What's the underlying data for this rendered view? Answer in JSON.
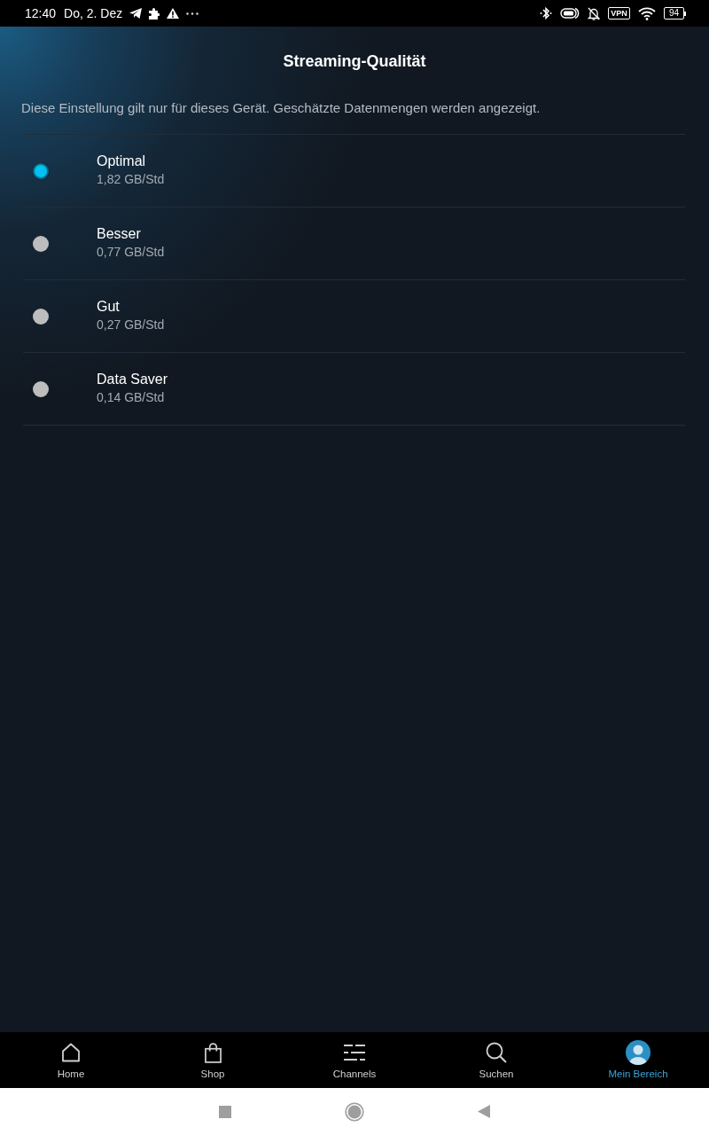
{
  "status_bar": {
    "time": "12:40",
    "date": "Do, 2. Dez",
    "vpn": "VPN",
    "battery": "94"
  },
  "header": {
    "title": "Streaming-Qualität",
    "description": "Diese Einstellung gilt nur für dieses Gerät. Geschätzte Datenmengen werden angezeigt."
  },
  "options": [
    {
      "label": "Optimal",
      "detail": "1,82 GB/Std",
      "selected": true
    },
    {
      "label": "Besser",
      "detail": "0,77 GB/Std",
      "selected": false
    },
    {
      "label": "Gut",
      "detail": "0,27 GB/Std",
      "selected": false
    },
    {
      "label": "Data Saver",
      "detail": "0,14 GB/Std",
      "selected": false
    }
  ],
  "bottom_nav": [
    {
      "kind": "home",
      "label": "Home",
      "selected": false
    },
    {
      "kind": "shop",
      "label": "Shop",
      "selected": false
    },
    {
      "kind": "channels",
      "label": "Channels",
      "selected": false
    },
    {
      "kind": "search",
      "label": "Suchen",
      "selected": false
    },
    {
      "kind": "profile",
      "label": "Mein Bereich",
      "selected": true
    }
  ]
}
